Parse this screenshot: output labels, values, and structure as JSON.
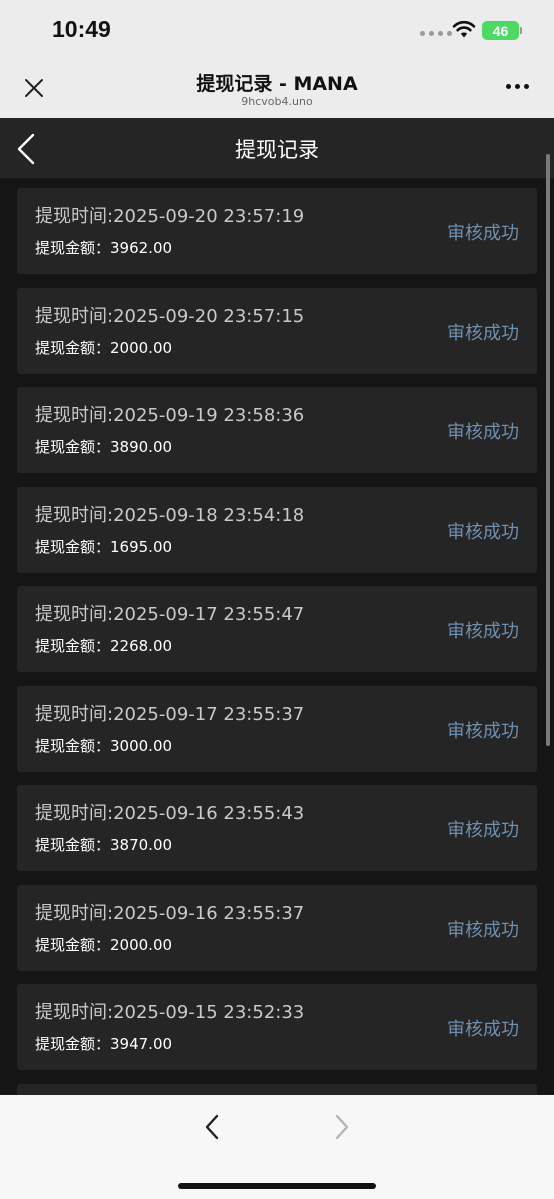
{
  "status_bar": {
    "time": "10:49",
    "battery": "46",
    "battery_color": "#4cd964",
    "icons": [
      "signal-dots-icon",
      "wifi-icon",
      "battery-icon"
    ]
  },
  "browser_header": {
    "title": "提现记录 - MANA",
    "url": "9hcvob4.uno",
    "close_icon": "close-icon",
    "more_icon": "more-icon"
  },
  "nav": {
    "title": "提现记录",
    "back_icon": "chevron-left-icon"
  },
  "records": [
    {
      "time": "提现时间:2025-09-20 23:57:19",
      "amount": "提现金额：3962.00",
      "status": "审核成功"
    },
    {
      "time": "提现时间:2025-09-20 23:57:15",
      "amount": "提现金额：2000.00",
      "status": "审核成功"
    },
    {
      "time": "提现时间:2025-09-19 23:58:36",
      "amount": "提现金额：3890.00",
      "status": "审核成功"
    },
    {
      "time": "提现时间:2025-09-18 23:54:18",
      "amount": "提现金额：1695.00",
      "status": "审核成功"
    },
    {
      "time": "提现时间:2025-09-17 23:55:47",
      "amount": "提现金额：2268.00",
      "status": "审核成功"
    },
    {
      "time": "提现时间:2025-09-17 23:55:37",
      "amount": "提现金额：3000.00",
      "status": "审核成功"
    },
    {
      "time": "提现时间:2025-09-16 23:55:43",
      "amount": "提现金额：3870.00",
      "status": "审核成功"
    },
    {
      "time": "提现时间:2025-09-16 23:55:37",
      "amount": "提现金额：2000.00",
      "status": "审核成功"
    },
    {
      "time": "提现时间:2025-09-15 23:52:33",
      "amount": "提现金额：3947.00",
      "status": "审核成功"
    }
  ],
  "colors": {
    "page_background": "#151515",
    "card_background": "#252525",
    "status_text": "#6f8fb0",
    "chrome_background": "#ececec"
  },
  "bottom_bar": {
    "back_icon": "chevron-left-icon",
    "forward_icon": "chevron-right-icon"
  }
}
